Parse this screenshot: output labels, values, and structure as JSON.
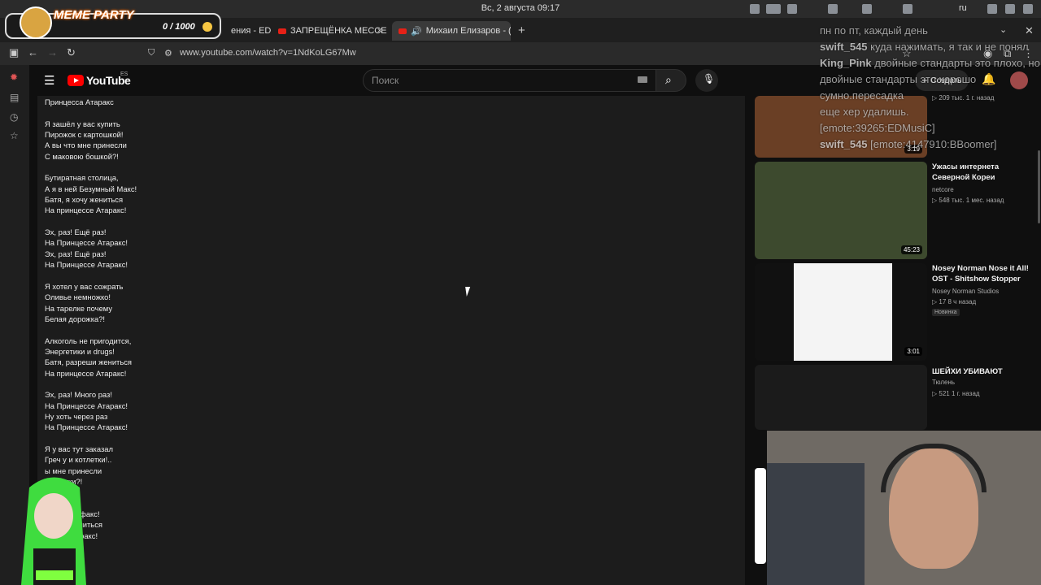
{
  "os": {
    "clock": "Вс, 2 августа  09:17",
    "lang": "ru"
  },
  "tabs": [
    {
      "label": "ения - ED",
      "close": "×"
    },
    {
      "label": "ЗАПРЕЩЁНКА МЕССЕН/",
      "close": "×"
    },
    {
      "label": "Михаил Елизаров - (",
      "close": "×"
    }
  ],
  "browser": {
    "new_tab": "+",
    "url": "www.youtube.com/watch?v=1NdKoLG67Mw"
  },
  "youtube": {
    "logo_text": "YouTube",
    "country": "ES",
    "search_placeholder": "Поиск",
    "create_label": "Создать"
  },
  "description": {
    "stanzas": [
      [
        "Принцесса Атаракс"
      ],
      [
        "Я зашёл у вас купить",
        "Пирожок с картошкой!",
        "А вы что мне принесли",
        "С маковою бошкой?!"
      ],
      [
        "Бутиратная столица,",
        "А я в ней Безумный Макс!",
        "Батя, я хочу жениться",
        "На принцессе Атаракс!"
      ],
      [
        "Эх, раз! Ещё раз!",
        "На Принцессе Атаракс!",
        "Эх, раз! Ещё раз!",
        "На Принцессе Атаракс!"
      ],
      [
        "Я хотел у вас сожрать",
        "Оливье немножко!",
        "На тарелке почему",
        "Белая дорожка?!"
      ],
      [
        "Алкоголь не пригодится,",
        "Энергетики и drugs!",
        "Батя, разреши жениться",
        "На принцессе Атаракс!"
      ],
      [
        "Эх, раз! Много раз!",
        "На Принцессе Атаракс!",
        "Ну хоть через раз",
        "На Принцессе Атаракс!"
      ],
      [
        "Я у вас тут заказал",
        "Греч у и котлетки!..",
        "ы мне принесли",
        "таблетки?!"
      ],
      [
        "страница,",
        "чик там и факс!",
        "овоню жениться",
        "цессе Атаракс!"
      ],
      [
        "и fax!",
        "ы Атаракс!"
      ]
    ]
  },
  "recommendations": [
    {
      "title": "",
      "channel": "",
      "meta": "▷ 209 тыс.  1 г. назад",
      "duration": "3:19",
      "thumb_color": "#6a3f25"
    },
    {
      "title": "Ужасы интернета Северной Кореи",
      "channel": "netcore",
      "meta": "▷ 548 тыс.  1 мес. назад",
      "duration": "45:23",
      "thumb_color": "#3d4a2e"
    },
    {
      "title": "Nosey Norman Nose it All! OST - Shitshow Stopper",
      "channel": "Nosey Norman Studios",
      "meta": "▷ 17  8 ч назад",
      "badge": "Новинка",
      "duration": "3:01",
      "thumb_color": "#f4f4f4"
    },
    {
      "title": "ШЕЙХИ УБИВАЮТ",
      "channel": "Тюлень",
      "meta": "▷ 521  1 г. назад",
      "duration": "",
      "thumb_color": "#1b1b1b"
    }
  ],
  "chat": [
    {
      "name": "",
      "text": "пн по пт, каждый день"
    },
    {
      "name": "swift_545",
      "text": "куда нажимать, я так и не понял"
    },
    {
      "name": "King_Pink",
      "text": "двойные стандарты это плохо, но двойные стандарты это хорошо"
    },
    {
      "name": "",
      "text": "сумно.пересадка"
    },
    {
      "name": "",
      "text": "еще хер удалишь."
    },
    {
      "name": "",
      "text": "[emote:39265:EDMusiC]"
    },
    {
      "name": "swift_545",
      "text": "[emote:4147910:BBoomer]"
    }
  ],
  "meme_party": {
    "title": "MEME PARTY",
    "count": "0 / 1000"
  },
  "colors": {
    "youtube_red": "#ff0000",
    "page_bg": "#0f0f0f",
    "desc_bg": "#1c1c1c"
  }
}
